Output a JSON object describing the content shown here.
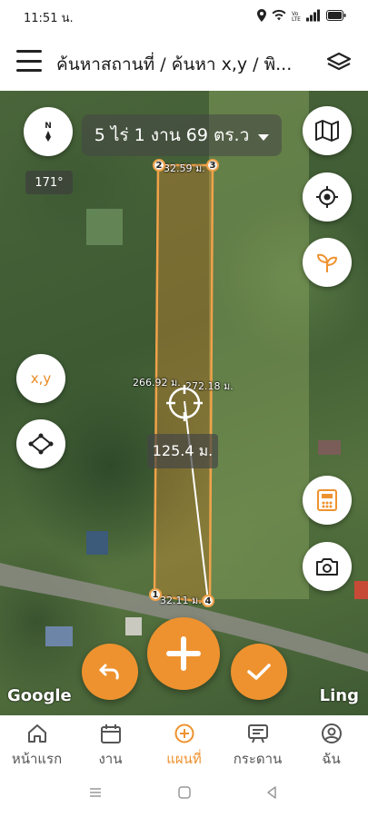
{
  "status_bar": {
    "time": "11:51 น.",
    "icons": [
      "location-icon",
      "wifi-icon",
      "volte-icon",
      "signal-icon",
      "battery-icon"
    ]
  },
  "header": {
    "title": "ค้นหาสถานที่ / ค้นหา x,y / พิ...",
    "menu_icon": "hamburger-icon",
    "layers_icon": "layers-icon"
  },
  "map": {
    "compass": {
      "letters": "N\nV"
    },
    "heading": "171°",
    "area_label": "5 ไร่ 1 งาน 69 ตร.ว",
    "xy_button": "x,y",
    "measurements": {
      "top_edge": "32.59 ม.",
      "bottom_edge": "32.11 ม.",
      "left_edge": "266.92 ม.",
      "right_edge": "272.18 ม.",
      "distance": "125.4 ม."
    },
    "vertices": [
      "1",
      "2",
      "3",
      "4"
    ],
    "attribution_left": "Google",
    "attribution_right": "Ling"
  },
  "colors": {
    "accent": "#ee922f",
    "polygon_stroke": "#f0a24a",
    "polygon_fill": "rgba(230,140,50,0.35)"
  },
  "bottom_nav": {
    "items": [
      {
        "label": "หน้าแรก",
        "icon": "home-icon",
        "active": false
      },
      {
        "label": "งาน",
        "icon": "calendar-icon",
        "active": false
      },
      {
        "label": "แผนที่",
        "icon": "add-circle-icon",
        "active": true
      },
      {
        "label": "กระดาน",
        "icon": "board-icon",
        "active": false
      },
      {
        "label": "ฉัน",
        "icon": "profile-icon",
        "active": false
      }
    ]
  },
  "system_nav": [
    "recents-icon",
    "home-square-icon",
    "back-icon"
  ]
}
